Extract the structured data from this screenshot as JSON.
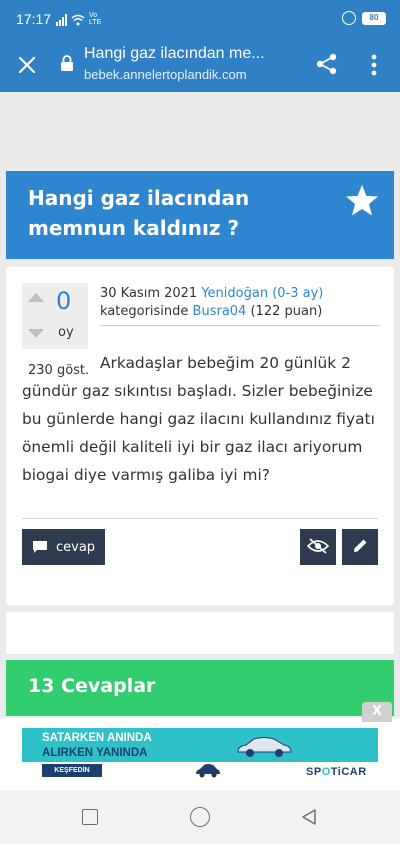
{
  "status_bar": {
    "time": "17:17",
    "network_label": "Vo LTE",
    "battery": "80"
  },
  "browser": {
    "page_title": "Hangi gaz ilacından me...",
    "url": "bebek.annelertoplandik.com"
  },
  "question": {
    "title": "Hangi gaz ilacından memnun kaldınız ?",
    "votes": "0",
    "votes_unit": "oy",
    "views": "230 göst.",
    "date": "30 Kasım 2021",
    "category": "Yenidoğan (0-3 ay)",
    "category_suffix": "kategorisinde",
    "author": "Busra04",
    "author_points": "(122 puan)",
    "body": "Arkadaşlar bebeğim 20 günlük 2 gündür gaz sıkıntısı başladı. Sizler bebeğinize bu günlerde hangi gaz ilacını kullandınız fiyatı önemli değil kaliteli iyi bir gaz ilacı ariyorum biogai diye varmış galiba iyi mi?",
    "answer_button_label": "cevap"
  },
  "answers": {
    "title": "13 Cevaplar"
  },
  "ad": {
    "close_label": "X",
    "line1": "SATARKEN ANINDA",
    "line2": "ALIRKEN YANINDA",
    "cta": "KEŞFEDİN",
    "brand_a": "SP",
    "brand_o": "O",
    "brand_b": "TiCAR"
  },
  "colors": {
    "header_blue": "#2f80c4",
    "title_blue": "#2d86cf",
    "answers_green": "#32cd6e",
    "button_dark": "#2e3b4e",
    "ad_teal": "#2fc1c9"
  }
}
